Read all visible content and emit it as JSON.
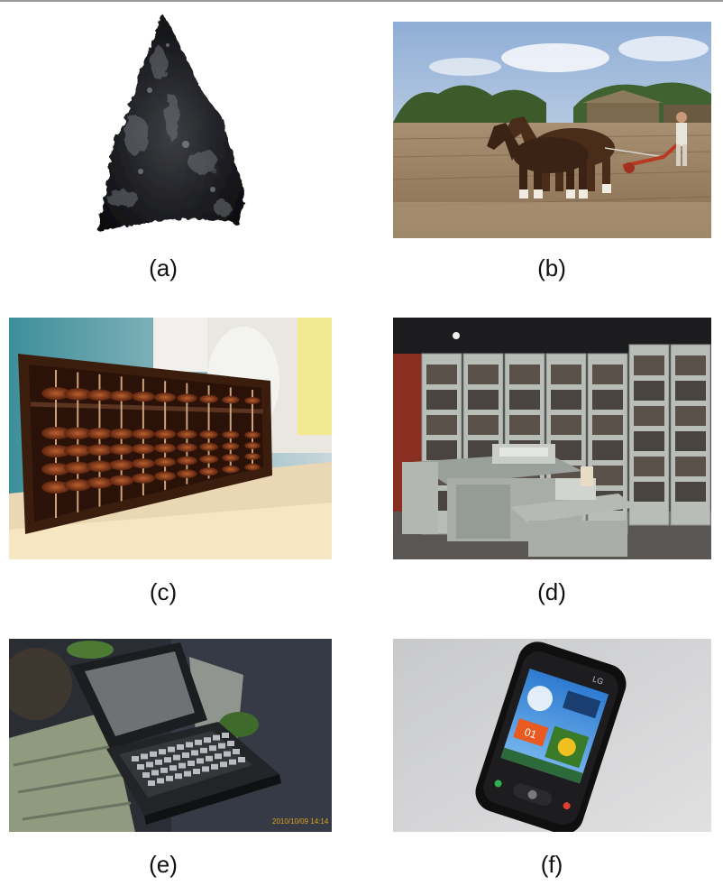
{
  "figure": {
    "panels": [
      {
        "label": "(a)",
        "subject": "stone arrowhead"
      },
      {
        "label": "(b)",
        "subject": "horses plowing a field"
      },
      {
        "label": "(c)",
        "subject": "wooden abacus"
      },
      {
        "label": "(d)",
        "subject": "early mainframe computer"
      },
      {
        "label": "(e)",
        "subject": "laptop computer",
        "timestamp": "2010/10/09  14:14"
      },
      {
        "label": "(f)",
        "subject": "touchscreen mobile phone",
        "brand": "LG",
        "screen_date": "01"
      }
    ]
  }
}
